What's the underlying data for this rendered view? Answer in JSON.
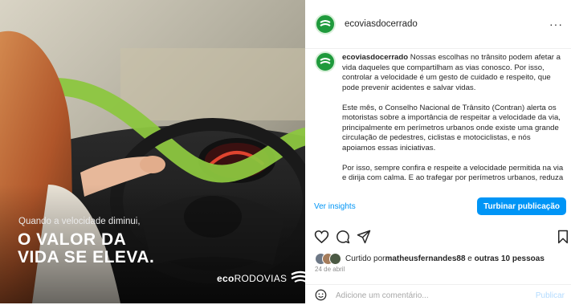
{
  "media": {
    "caption_small": "Quando a velocidade diminui,",
    "headline_line1": "O VALOR DA",
    "headline_line2": "VIDA SE ELEVA.",
    "brand_bold": "eco",
    "brand_rest": "RODOVIAS"
  },
  "header": {
    "username": "ecoviasdocerrado",
    "more_label": "···"
  },
  "caption": {
    "author": "ecoviasdocerrado",
    "paragraph1": " Nossas escolhas no trânsito podem afetar a vida daqueles que compartilham as vias conosco. Por isso, controlar a velocidade é um gesto de cuidado e respeito, que pode prevenir acidentes e salvar vidas.",
    "paragraph2": "Este mês, o Conselho Nacional de Trânsito (Contran) alerta os motoristas sobre a importância de respeitar a velocidade da via, principalmente em perímetros urbanos onde existe uma grande circulação de pedestres, ciclistas e motociclistas, e nós apoiamos essas iniciativas.",
    "paragraph3": "Por isso, sempre confira e respeite a velocidade permitida na via e dirija com calma. E ao trafegar por perímetros urbanos, reduza"
  },
  "insights": {
    "link_label": "Ver insights",
    "boost_label": "Turbinar publicação"
  },
  "likes": {
    "prefix": "Curtido por ",
    "user": "matheusfernandes88",
    "middle": " e ",
    "others": "outras 10 pessoas"
  },
  "date": "24 de abril",
  "comment": {
    "placeholder": "Adicione um comentário...",
    "publish_label": "Publicar"
  },
  "colors": {
    "accent": "#0095f6",
    "brand_green": "#1f9a3c",
    "ribbon_green": "#8cc63f"
  },
  "icons": [
    "heart-icon",
    "comment-icon",
    "share-icon",
    "bookmark-icon",
    "emoji-icon",
    "more-icon"
  ]
}
